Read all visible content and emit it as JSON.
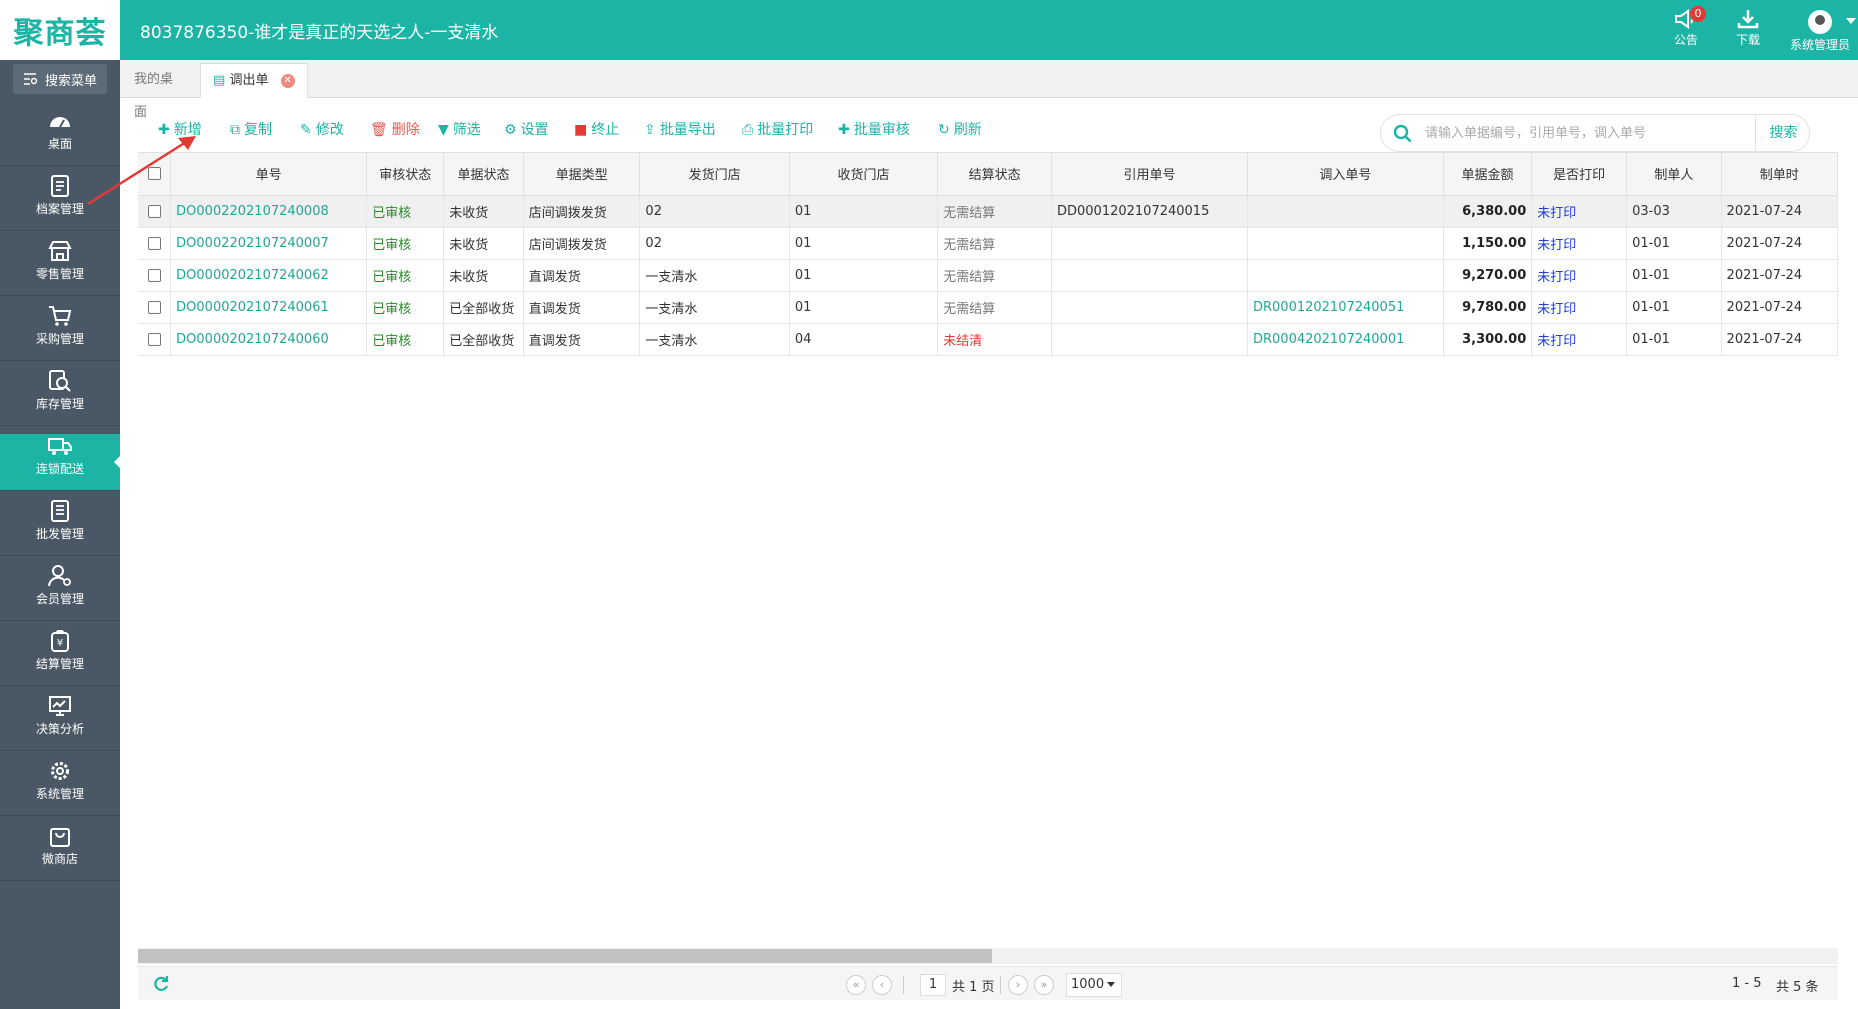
{
  "header": {
    "logo": "聚商荟",
    "title": "8037876350-谁才是真正的天选之人-一支清水",
    "notice": {
      "label": "公告",
      "badge": "0"
    },
    "download": {
      "label": "下载"
    },
    "user": {
      "label": "系统管理员"
    }
  },
  "sidebar": {
    "search_label": "搜索菜单",
    "items": [
      {
        "label": "桌面",
        "icon": "dashboard-icon"
      },
      {
        "label": "档案管理",
        "icon": "archive-icon"
      },
      {
        "label": "零售管理",
        "icon": "store-icon"
      },
      {
        "label": "采购管理",
        "icon": "cart-icon"
      },
      {
        "label": "库存管理",
        "icon": "inventory-search-icon"
      },
      {
        "label": "连锁配送",
        "icon": "delivery-truck-icon",
        "active": true
      },
      {
        "label": "批发管理",
        "icon": "wholesale-icon"
      },
      {
        "label": "会员管理",
        "icon": "member-icon"
      },
      {
        "label": "结算管理",
        "icon": "settlement-icon"
      },
      {
        "label": "决策分析",
        "icon": "analytics-icon"
      },
      {
        "label": "系统管理",
        "icon": "settings-gear-icon"
      },
      {
        "label": "微商店",
        "icon": "shop-bag-icon"
      }
    ]
  },
  "tabs": [
    {
      "label": "我的桌面"
    },
    {
      "label": "调出单",
      "active": true
    }
  ],
  "toolbar": {
    "add": "新增",
    "copy": "复制",
    "edit": "修改",
    "delete": "删除",
    "filter": "筛选",
    "settings": "设置",
    "stop": "终止",
    "batch_export": "批量导出",
    "batch_print": "批量打印",
    "batch_audit": "批量审核",
    "refresh": "刷新"
  },
  "search": {
    "placeholder": "请输入单据编号，引用单号，调入单号",
    "value": "",
    "button": "搜索"
  },
  "table": {
    "columns": [
      "单号",
      "审核状态",
      "单据状态",
      "单据类型",
      "发货门店",
      "收货门店",
      "结算状态",
      "引用单号",
      "调入单号",
      "单据金额",
      "是否打印",
      "制单人",
      "制单时"
    ],
    "rows": [
      {
        "no": "DO0002202107240008",
        "audit": "已审核",
        "status": "未收货",
        "type": "店间调拨发货",
        "from": "02",
        "to": "01",
        "settle": "无需结算",
        "ref": "DD0001202107240015",
        "in_no": "",
        "amount": "6,380.00",
        "print": "未打印",
        "maker": "03-03",
        "time": "2021-07-24",
        "selected": true
      },
      {
        "no": "DO0002202107240007",
        "audit": "已审核",
        "status": "未收货",
        "type": "店间调拨发货",
        "from": "02",
        "to": "01",
        "settle": "无需结算",
        "ref": "",
        "in_no": "",
        "amount": "1,150.00",
        "print": "未打印",
        "maker": "01-01",
        "time": "2021-07-24"
      },
      {
        "no": "DO0000202107240062",
        "audit": "已审核",
        "status": "未收货",
        "type": "直调发货",
        "from": "一支清水",
        "to": "01",
        "settle": "无需结算",
        "ref": "",
        "in_no": "",
        "amount": "9,270.00",
        "print": "未打印",
        "maker": "01-01",
        "time": "2021-07-24"
      },
      {
        "no": "DO0000202107240061",
        "audit": "已审核",
        "status": "已全部收货",
        "type": "直调发货",
        "from": "一支清水",
        "to": "01",
        "settle": "无需结算",
        "ref": "",
        "in_no": "DR0001202107240051",
        "amount": "9,780.00",
        "print": "未打印",
        "maker": "01-01",
        "time": "2021-07-24"
      },
      {
        "no": "DO0000202107240060",
        "audit": "已审核",
        "status": "已全部收货",
        "type": "直调发货",
        "from": "一支清水",
        "to": "04",
        "settle": "未结清",
        "ref": "",
        "in_no": "DR0004202107240001",
        "amount": "3,300.00",
        "print": "未打印",
        "maker": "01-01",
        "time": "2021-07-24",
        "settle_unpaid": true
      }
    ]
  },
  "pager": {
    "page": "1",
    "total_pages": "共 1 页",
    "page_size": "1000",
    "range": "1 - 5",
    "total": "共 5 条"
  },
  "colors": {
    "accent": "#1cb5a5",
    "sidebar": "#4a5866",
    "link": "#1fa896",
    "approved": "#2a8a2a",
    "unpaid": "#e53935",
    "unprinted": "#1f3fd1",
    "annotation_arrow": "#e53935"
  }
}
